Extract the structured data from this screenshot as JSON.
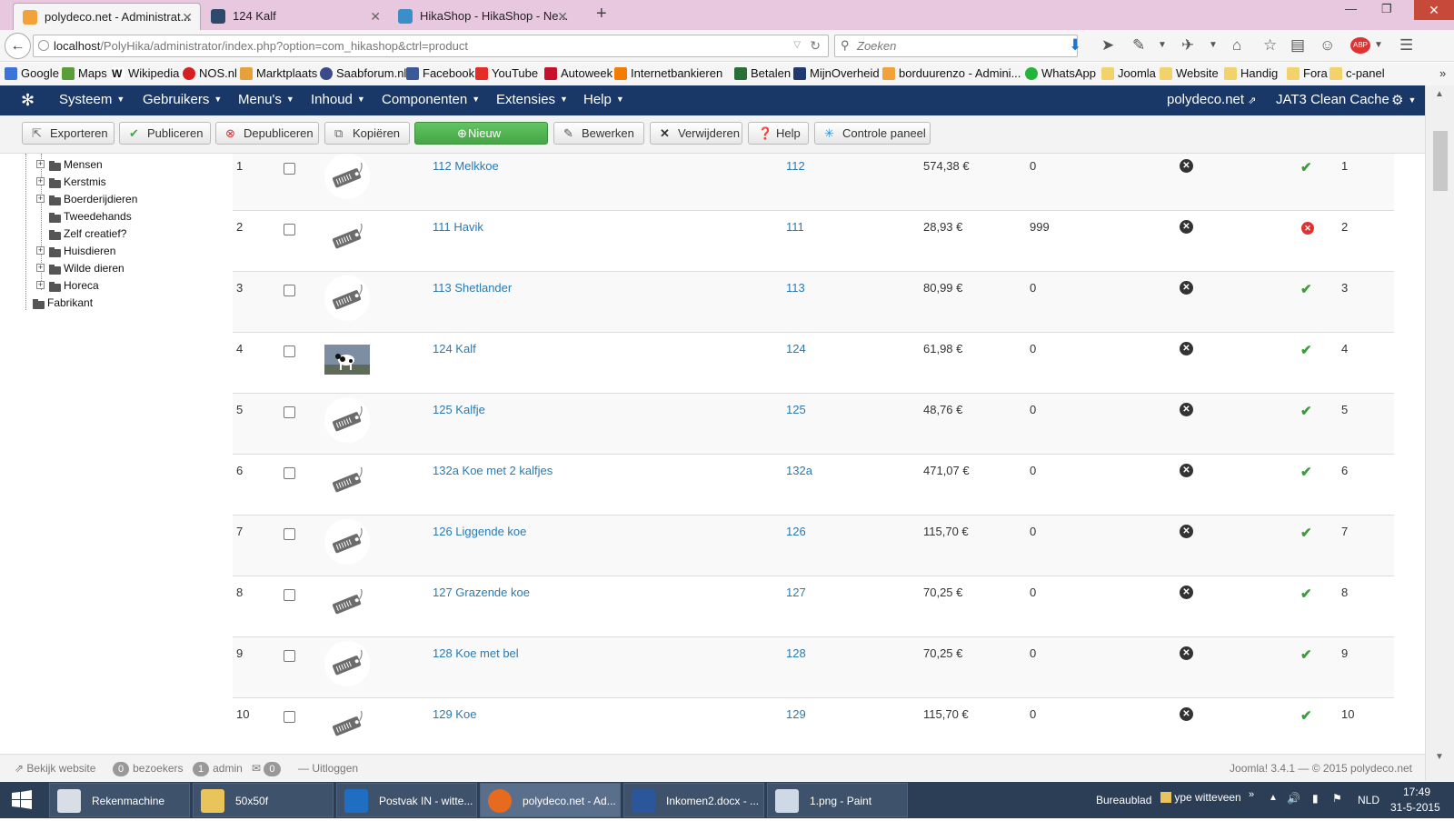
{
  "browser": {
    "tabs": [
      {
        "title": "polydeco.net - Administrat...",
        "active": true
      },
      {
        "title": "124 Kalf",
        "active": false
      },
      {
        "title": "HikaShop - HikaShop - Ne...",
        "active": false
      }
    ],
    "url_host": "localhost",
    "url_path": "/PolyHika/administrator/index.php?option=com_hikashop&ctrl=product",
    "search_placeholder": "Zoeken",
    "bookmarks": [
      "Google",
      "Maps",
      "Wikipedia",
      "NOS.nl",
      "Marktplaats",
      "Saabforum.nl",
      "Facebook",
      "YouTube",
      "Autoweek",
      "Internetbankieren",
      "Betalen",
      "MijnOverheid",
      "borduurenzo - Admini...",
      "WhatsApp",
      "Joomla",
      "Website",
      "Handig",
      "Fora",
      "c-panel"
    ]
  },
  "joomla": {
    "menu": [
      "Systeem",
      "Gebruikers",
      "Menu's",
      "Inhoud",
      "Componenten",
      "Extensies",
      "Help"
    ],
    "site_link": "polydeco.net",
    "cache": "JAT3 Clean Cache",
    "brand_color": "#1a3867"
  },
  "toolbar": {
    "buttons": [
      "Exporteren",
      "Publiceren",
      "Depubliceren",
      "Kopiëren",
      "Nieuw",
      "Bewerken",
      "Verwijderen",
      "Help",
      "Controle paneel"
    ]
  },
  "tree": {
    "items": [
      "Mensen",
      "Kerstmis",
      "Boerderijdieren",
      "Tweedehands",
      "Zelf creatief?",
      "Huisdieren",
      "Wilde dieren",
      "Horeca",
      "Fabrikant"
    ]
  },
  "products": [
    {
      "num": "1",
      "name": "112 Melkkoe",
      "code": "112",
      "price": "574,38 €",
      "qty": "0",
      "published": true,
      "order": "1",
      "image": "placeholder"
    },
    {
      "num": "2",
      "name": "111 Havik",
      "code": "111",
      "price": "28,93 €",
      "qty": "999",
      "published": false,
      "order": "2",
      "image": "placeholder"
    },
    {
      "num": "3",
      "name": "113 Shetlander",
      "code": "113",
      "price": "80,99 €",
      "qty": "0",
      "published": true,
      "order": "3",
      "image": "placeholder"
    },
    {
      "num": "4",
      "name": "124 Kalf",
      "code": "124",
      "price": "61,98 €",
      "qty": "0",
      "published": true,
      "order": "4",
      "image": "photo"
    },
    {
      "num": "5",
      "name": "125 Kalfje",
      "code": "125",
      "price": "48,76 €",
      "qty": "0",
      "published": true,
      "order": "5",
      "image": "placeholder"
    },
    {
      "num": "6",
      "name": "132a Koe met 2 kalfjes",
      "code": "132a",
      "price": "471,07 €",
      "qty": "0",
      "published": true,
      "order": "6",
      "image": "placeholder"
    },
    {
      "num": "7",
      "name": "126 Liggende koe",
      "code": "126",
      "price": "115,70 €",
      "qty": "0",
      "published": true,
      "order": "7",
      "image": "placeholder"
    },
    {
      "num": "8",
      "name": "127 Grazende koe",
      "code": "127",
      "price": "70,25 €",
      "qty": "0",
      "published": true,
      "order": "8",
      "image": "placeholder"
    },
    {
      "num": "9",
      "name": "128 Koe met bel",
      "code": "128",
      "price": "70,25 €",
      "qty": "0",
      "published": true,
      "order": "9",
      "image": "placeholder"
    },
    {
      "num": "10",
      "name": "129 Koe",
      "code": "129",
      "price": "115,70 €",
      "qty": "0",
      "published": true,
      "order": "10",
      "image": "placeholder"
    }
  ],
  "status": {
    "view_site": "Bekijk website",
    "visitors_count": "0",
    "visitors": "bezoekers",
    "admin_count": "1",
    "admin": "admin",
    "msg_count": "0",
    "logout": "Uitloggen",
    "version": "Joomla! 3.4.1 — © 2015 polydeco.net"
  },
  "taskbar": {
    "items": [
      "Rekenmachine",
      "50x50f",
      "Postvak IN - witte...",
      "polydeco.net - Ad...",
      "Inkomen2.docx - ...",
      "1.png - Paint"
    ],
    "desktop": "Bureaublad",
    "user": "ype witteveen",
    "lang": "NLD",
    "time": "17:49",
    "date": "31-5-2015"
  }
}
